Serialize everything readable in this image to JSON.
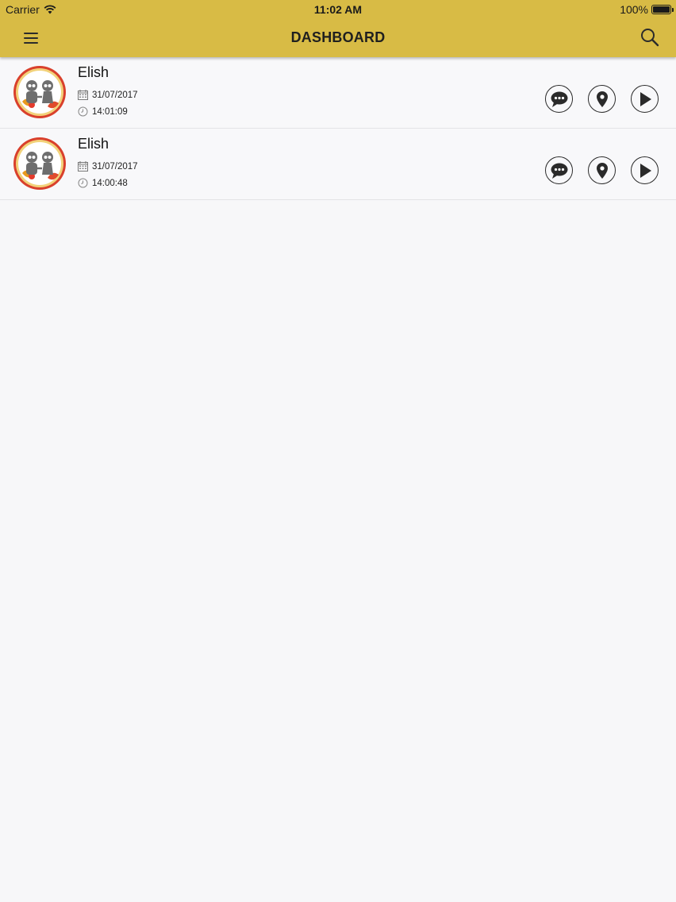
{
  "status_bar": {
    "carrier": "Carrier",
    "time": "11:02 AM",
    "battery": "100%"
  },
  "navbar": {
    "title": "DASHBOARD"
  },
  "entries": [
    {
      "name": "Elish",
      "date": "31/07/2017",
      "time": "14:01:09"
    },
    {
      "name": "Elish",
      "date": "31/07/2017",
      "time": "14:00:48"
    }
  ],
  "colors": {
    "header": "#d8bb45",
    "background": "#f7f7f9",
    "icon": "#2a2a2a"
  },
  "icons": {
    "menu": "hamburger-icon",
    "search": "search-icon",
    "message": "chat-bubble-icon",
    "location": "map-pin-icon",
    "play": "play-icon",
    "calendar": "calendar-icon",
    "clock": "clock-icon"
  }
}
